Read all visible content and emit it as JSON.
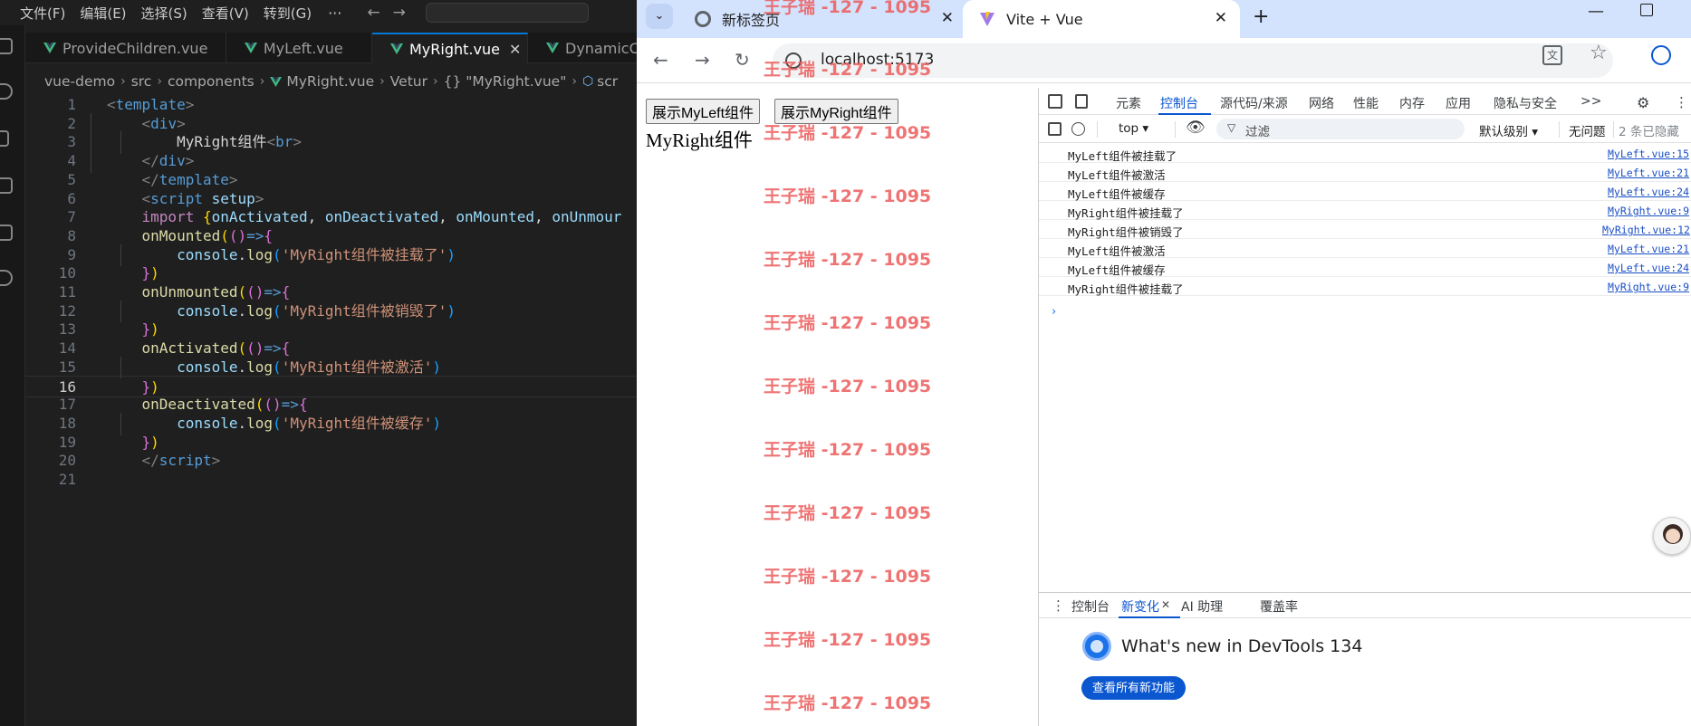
{
  "vscode": {
    "menu": [
      "文件(F)",
      "编辑(E)",
      "选择(S)",
      "查看(V)",
      "转到(G)"
    ],
    "menu_more": "···",
    "tabs": [
      {
        "label": "ProvideChildren.vue"
      },
      {
        "label": "MyLeft.vue"
      },
      {
        "label": "MyRight.vue",
        "close": "✕"
      },
      {
        "label": "DynamicC"
      }
    ],
    "breadcrumb": [
      "vue-demo",
      "src",
      "components",
      "MyRight.vue",
      "Vetur",
      "{} \"MyRight.vue\"",
      "scr"
    ],
    "current_line": 16,
    "line_numbers": [
      "1",
      "2",
      "3",
      "4",
      "5",
      "6",
      "7",
      "8",
      "9",
      "10",
      "11",
      "12",
      "13",
      "14",
      "15",
      "16",
      "17",
      "18",
      "19",
      "20",
      "21"
    ]
  },
  "chrome": {
    "tabs": [
      {
        "label": "新标签页"
      },
      {
        "label": "Vite + Vue"
      }
    ],
    "url": "localhost:5173",
    "page": {
      "buttons": [
        "展示MyLeft组件",
        "展示MyRight组件"
      ],
      "text": "MyRight组件",
      "watermark": "王子瑞 -127 - 1095"
    },
    "devtools": {
      "tabs": [
        "元素",
        "控制台",
        "源代码/来源",
        "网络",
        "性能",
        "内存",
        "应用",
        "隐私与安全",
        ">>"
      ],
      "context": "top ▾",
      "filter_placeholder": "过滤",
      "levels": "默认级别 ▾",
      "issues": "无问题",
      "hidden": "2 条已隐藏",
      "logs": [
        {
          "msg": "MyLeft组件被挂载了",
          "src": "MyLeft.vue:15"
        },
        {
          "msg": "MyLeft组件被激活",
          "src": "MyLeft.vue:21"
        },
        {
          "msg": "MyLeft组件被缓存",
          "src": "MyLeft.vue:24"
        },
        {
          "msg": "MyRight组件被挂载了",
          "src": "MyRight.vue:9"
        },
        {
          "msg": "MyRight组件被销毁了",
          "src": "MyRight.vue:12"
        },
        {
          "msg": "MyLeft组件被激活",
          "src": "MyLeft.vue:21"
        },
        {
          "msg": "MyLeft组件被缓存",
          "src": "MyLeft.vue:24"
        },
        {
          "msg": "MyRight组件被挂载了",
          "src": "MyRight.vue:9"
        }
      ],
      "drawer": {
        "tabs": [
          "控制台",
          "新变化",
          "AI 助理",
          "覆盖率"
        ],
        "whatsnew_title": "What's new in DevTools 134",
        "whatsnew_button": "查看所有新功能"
      }
    }
  }
}
